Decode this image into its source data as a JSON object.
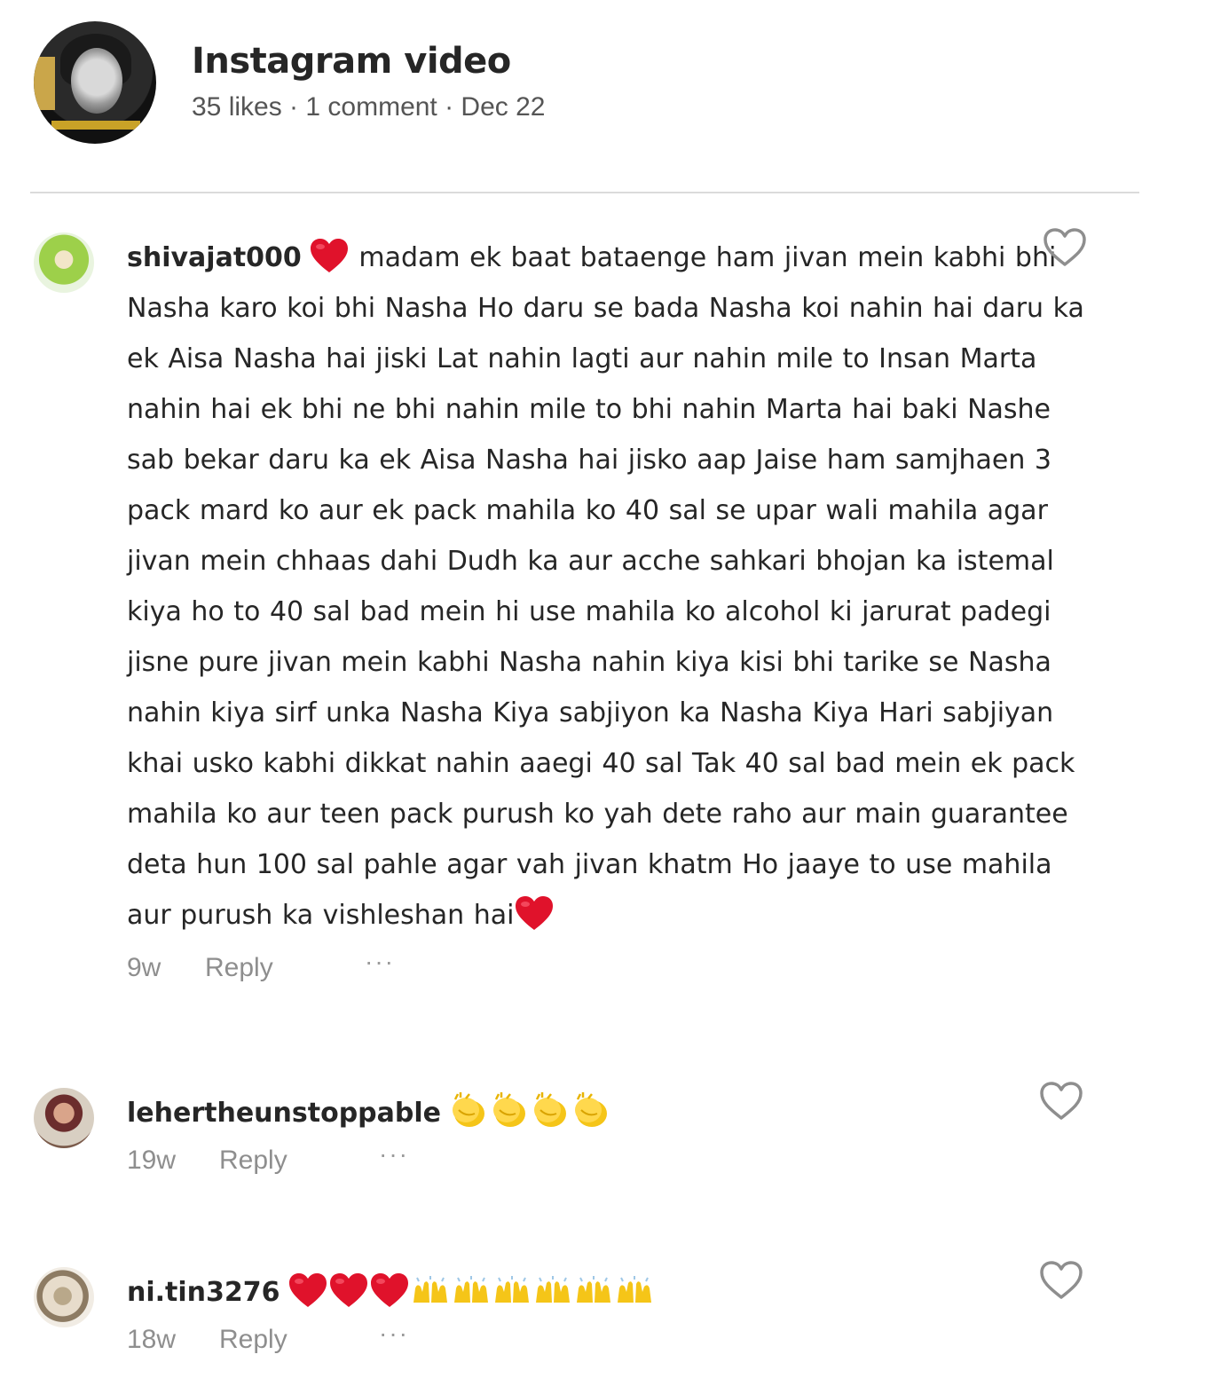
{
  "post": {
    "title": "Instagram video",
    "meta": "35 likes · 1 comment · Dec 22"
  },
  "comments": [
    {
      "username": "shivajat000",
      "text": "madam ek baat bataenge ham jivan mein kabhi bhi Nasha karo koi bhi Nasha Ho daru se bada Nasha koi nahin hai daru ka ek Aisa Nasha hai jiski Lat nahin lagti aur nahin mile to Insan Marta nahin hai ek bhi ne bhi nahin mile to bhi nahin Marta hai baki Nashe sab bekar daru ka ek Aisa Nasha hai jisko aap Jaise ham samjhaen 3 pack mard ko aur ek pack mahila ko 40 sal se upar wali mahila agar jivan mein chhaas dahi Dudh ka aur acche sahkari bhojan ka istemal kiya ho to 40 sal bad mein hi use mahila ko alcohol ki jarurat padegi jisne pure jivan mein kabhi Nasha nahin kiya kisi bhi tarike se Nasha nahin kiya sirf unka Nasha Kiya sabjiyon ka Nasha Kiya Hari sabjiyan khai usko kabhi dikkat nahin aaegi 40 sal Tak 40 sal bad mein ek pack mahila ko aur teen pack purush ko yah dete raho aur main guarantee deta hun 100 sal pahle agar vah jivan khatm Ho jaaye to use mahila aur purush ka vishleshan hai",
      "time": "9w",
      "reply": "Reply",
      "more": "···"
    },
    {
      "username": "lehertheunstoppable",
      "time": "19w",
      "reply": "Reply",
      "more": "···"
    },
    {
      "username": "ni.tin3276",
      "time": "18w",
      "reply": "Reply",
      "more": "···"
    }
  ],
  "colors": {
    "heart_emoji": "#e0122b",
    "clap_emoji": "#f5c518",
    "secondary_text": "#8e8e8e"
  },
  "icons": {
    "like": "heart-outline-icon",
    "emoji_heart": "red-heart-emoji",
    "emoji_clap": "clapping-hands-emoji",
    "emoji_raised": "raised-hands-emoji"
  }
}
